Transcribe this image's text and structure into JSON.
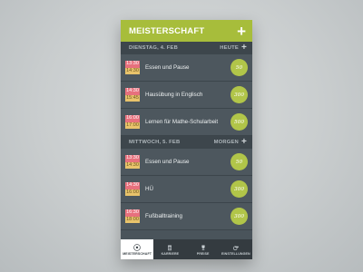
{
  "header": {
    "title": "MEISTERSCHAFT",
    "add_icon": "plus-icon"
  },
  "days": [
    {
      "date_label": "DIENSTAG, 4. FEB",
      "right_label": "HEUTE",
      "entries": [
        {
          "start": "13:30",
          "end": "14:30",
          "title": "Essen und Pause",
          "points": "50"
        },
        {
          "start": "14:30",
          "end": "15:45",
          "title": "Hausübung in Englisch",
          "points": "300"
        },
        {
          "start": "16:00",
          "end": "17:00",
          "title": "Lernen für Mathe-Schularbeit",
          "points": "500"
        }
      ]
    },
    {
      "date_label": "MITTWOCH, 5. FEB",
      "right_label": "MORGEN",
      "entries": [
        {
          "start": "13:30",
          "end": "14:30",
          "title": "Essen und Pause",
          "points": "50"
        },
        {
          "start": "14:30",
          "end": "16:00",
          "title": "HÜ",
          "points": "300"
        },
        {
          "start": "16:30",
          "end": "18:00",
          "title": "Fußballtraining",
          "points": "300"
        }
      ]
    }
  ],
  "tabs": [
    {
      "label": "MEISTERSCHAFT",
      "icon": "soccer-ball-icon",
      "active": true
    },
    {
      "label": "KARRIERE",
      "icon": "trash-icon",
      "active": false
    },
    {
      "label": "PREISE",
      "icon": "trophy-icon",
      "active": false
    },
    {
      "label": "EINSTELLUNGEN",
      "icon": "whistle-icon",
      "active": false
    }
  ],
  "colors": {
    "accent": "#a7bd3b",
    "start_time": "#e7707d",
    "end_time": "#e8c36b",
    "list_bg": "#4d575e"
  }
}
